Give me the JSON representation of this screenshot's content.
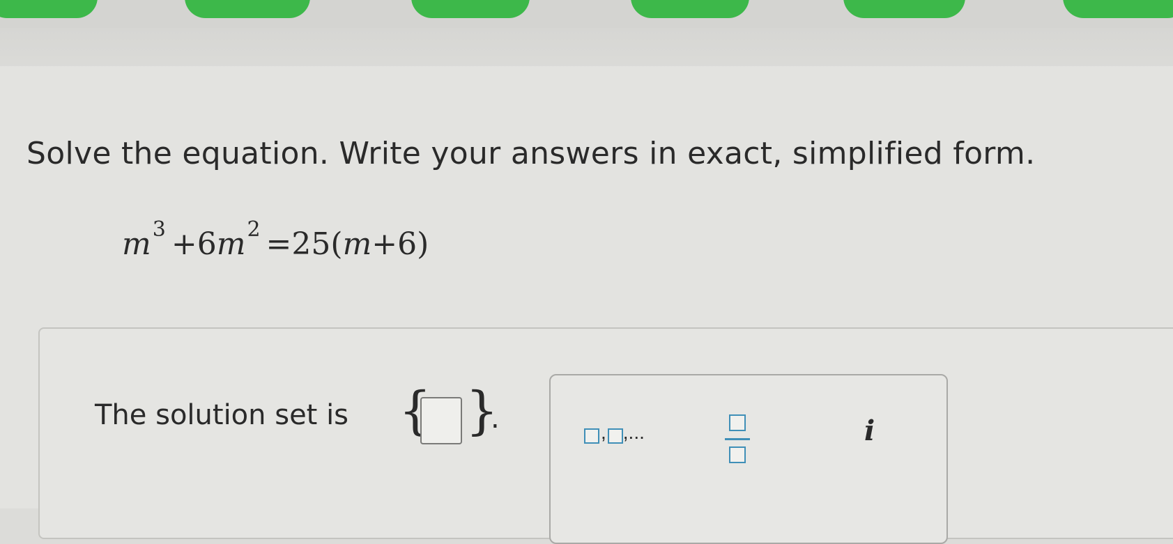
{
  "instructions": "Solve the equation. Write your answers in exact, simplified form.",
  "equation": {
    "var1": "m",
    "exp1": "3",
    "mid": "+6",
    "var2": "m",
    "exp2": "2",
    "rhs_start": "=25(",
    "var3": "m",
    "rhs_end": "+6)"
  },
  "answer": {
    "label": "The solution set is",
    "open_brace": "{",
    "close_brace": "}",
    "period": ".",
    "value": ""
  },
  "palette": {
    "list_comma": ",",
    "list_ellipsis": ",...",
    "imaginary": "i"
  },
  "colors": {
    "tab_green": "#3db84a",
    "palette_accent": "#3f8fb7"
  }
}
